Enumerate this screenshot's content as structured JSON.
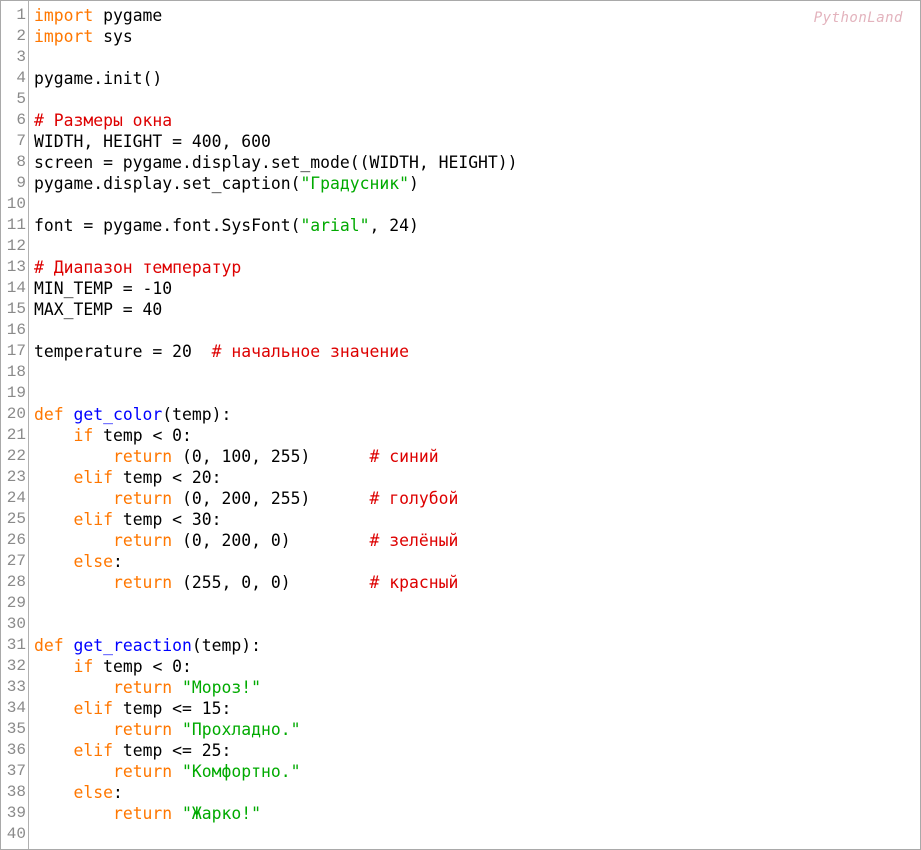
{
  "watermark": "PythonLand",
  "colors": {
    "keyword": "#ff7700",
    "function": "#0000ff",
    "string": "#00aa00",
    "comment": "#dd0000",
    "text": "#000000",
    "line_number": "#8a8a8a",
    "watermark": "#e3b3bd"
  },
  "lines": [
    {
      "num": "1",
      "tokens": [
        {
          "t": "kw",
          "v": "import"
        },
        {
          "t": "txt",
          "v": " pygame"
        }
      ]
    },
    {
      "num": "2",
      "tokens": [
        {
          "t": "kw",
          "v": "import"
        },
        {
          "t": "txt",
          "v": " sys"
        }
      ]
    },
    {
      "num": "3",
      "tokens": []
    },
    {
      "num": "4",
      "tokens": [
        {
          "t": "txt",
          "v": "pygame.init()"
        }
      ]
    },
    {
      "num": "5",
      "tokens": []
    },
    {
      "num": "6",
      "tokens": [
        {
          "t": "com",
          "v": "# Размеры окна"
        }
      ]
    },
    {
      "num": "7",
      "tokens": [
        {
          "t": "txt",
          "v": "WIDTH, HEIGHT = 400, 600"
        }
      ]
    },
    {
      "num": "8",
      "tokens": [
        {
          "t": "txt",
          "v": "screen = pygame.display.set_mode((WIDTH, HEIGHT))"
        }
      ]
    },
    {
      "num": "9",
      "tokens": [
        {
          "t": "txt",
          "v": "pygame.display.set_caption("
        },
        {
          "t": "str",
          "v": "\"Градусник\""
        },
        {
          "t": "txt",
          "v": ")"
        }
      ]
    },
    {
      "num": "10",
      "tokens": []
    },
    {
      "num": "11",
      "tokens": [
        {
          "t": "txt",
          "v": "font = pygame.font.SysFont("
        },
        {
          "t": "str",
          "v": "\"arial\""
        },
        {
          "t": "txt",
          "v": ", 24)"
        }
      ]
    },
    {
      "num": "12",
      "tokens": []
    },
    {
      "num": "13",
      "tokens": [
        {
          "t": "com",
          "v": "# Диапазон температур"
        }
      ]
    },
    {
      "num": "14",
      "tokens": [
        {
          "t": "txt",
          "v": "MIN_TEMP = -10"
        }
      ]
    },
    {
      "num": "15",
      "tokens": [
        {
          "t": "txt",
          "v": "MAX_TEMP = 40"
        }
      ]
    },
    {
      "num": "16",
      "tokens": []
    },
    {
      "num": "17",
      "tokens": [
        {
          "t": "txt",
          "v": "temperature = 20  "
        },
        {
          "t": "com",
          "v": "# начальное значение"
        }
      ]
    },
    {
      "num": "18",
      "tokens": []
    },
    {
      "num": "19",
      "tokens": []
    },
    {
      "num": "20",
      "tokens": [
        {
          "t": "kw",
          "v": "def"
        },
        {
          "t": "txt",
          "v": " "
        },
        {
          "t": "fn",
          "v": "get_color"
        },
        {
          "t": "txt",
          "v": "(temp):"
        }
      ]
    },
    {
      "num": "21",
      "tokens": [
        {
          "t": "txt",
          "v": "    "
        },
        {
          "t": "kw",
          "v": "if"
        },
        {
          "t": "txt",
          "v": " temp < 0:"
        }
      ]
    },
    {
      "num": "22",
      "tokens": [
        {
          "t": "txt",
          "v": "        "
        },
        {
          "t": "kw",
          "v": "return"
        },
        {
          "t": "txt",
          "v": " (0, 100, 255)      "
        },
        {
          "t": "com",
          "v": "# синий"
        }
      ]
    },
    {
      "num": "23",
      "tokens": [
        {
          "t": "txt",
          "v": "    "
        },
        {
          "t": "kw",
          "v": "elif"
        },
        {
          "t": "txt",
          "v": " temp < 20:"
        }
      ]
    },
    {
      "num": "24",
      "tokens": [
        {
          "t": "txt",
          "v": "        "
        },
        {
          "t": "kw",
          "v": "return"
        },
        {
          "t": "txt",
          "v": " (0, 200, 255)      "
        },
        {
          "t": "com",
          "v": "# голубой"
        }
      ]
    },
    {
      "num": "25",
      "tokens": [
        {
          "t": "txt",
          "v": "    "
        },
        {
          "t": "kw",
          "v": "elif"
        },
        {
          "t": "txt",
          "v": " temp < 30:"
        }
      ]
    },
    {
      "num": "26",
      "tokens": [
        {
          "t": "txt",
          "v": "        "
        },
        {
          "t": "kw",
          "v": "return"
        },
        {
          "t": "txt",
          "v": " (0, 200, 0)        "
        },
        {
          "t": "com",
          "v": "# зелёный"
        }
      ]
    },
    {
      "num": "27",
      "tokens": [
        {
          "t": "txt",
          "v": "    "
        },
        {
          "t": "kw",
          "v": "else"
        },
        {
          "t": "txt",
          "v": ":"
        }
      ]
    },
    {
      "num": "28",
      "tokens": [
        {
          "t": "txt",
          "v": "        "
        },
        {
          "t": "kw",
          "v": "return"
        },
        {
          "t": "txt",
          "v": " (255, 0, 0)        "
        },
        {
          "t": "com",
          "v": "# красный"
        }
      ]
    },
    {
      "num": "29",
      "tokens": []
    },
    {
      "num": "30",
      "tokens": []
    },
    {
      "num": "31",
      "tokens": [
        {
          "t": "kw",
          "v": "def"
        },
        {
          "t": "txt",
          "v": " "
        },
        {
          "t": "fn",
          "v": "get_reaction"
        },
        {
          "t": "txt",
          "v": "(temp):"
        }
      ]
    },
    {
      "num": "32",
      "tokens": [
        {
          "t": "txt",
          "v": "    "
        },
        {
          "t": "kw",
          "v": "if"
        },
        {
          "t": "txt",
          "v": " temp < 0:"
        }
      ]
    },
    {
      "num": "33",
      "tokens": [
        {
          "t": "txt",
          "v": "        "
        },
        {
          "t": "kw",
          "v": "return"
        },
        {
          "t": "txt",
          "v": " "
        },
        {
          "t": "str",
          "v": "\"Мороз!\""
        }
      ]
    },
    {
      "num": "34",
      "tokens": [
        {
          "t": "txt",
          "v": "    "
        },
        {
          "t": "kw",
          "v": "elif"
        },
        {
          "t": "txt",
          "v": " temp <= 15:"
        }
      ]
    },
    {
      "num": "35",
      "tokens": [
        {
          "t": "txt",
          "v": "        "
        },
        {
          "t": "kw",
          "v": "return"
        },
        {
          "t": "txt",
          "v": " "
        },
        {
          "t": "str",
          "v": "\"Прохладно.\""
        }
      ]
    },
    {
      "num": "36",
      "tokens": [
        {
          "t": "txt",
          "v": "    "
        },
        {
          "t": "kw",
          "v": "elif"
        },
        {
          "t": "txt",
          "v": " temp <= 25:"
        }
      ]
    },
    {
      "num": "37",
      "tokens": [
        {
          "t": "txt",
          "v": "        "
        },
        {
          "t": "kw",
          "v": "return"
        },
        {
          "t": "txt",
          "v": " "
        },
        {
          "t": "str",
          "v": "\"Комфортно.\""
        }
      ]
    },
    {
      "num": "38",
      "tokens": [
        {
          "t": "txt",
          "v": "    "
        },
        {
          "t": "kw",
          "v": "else"
        },
        {
          "t": "txt",
          "v": ":"
        }
      ]
    },
    {
      "num": "39",
      "tokens": [
        {
          "t": "txt",
          "v": "        "
        },
        {
          "t": "kw",
          "v": "return"
        },
        {
          "t": "txt",
          "v": " "
        },
        {
          "t": "str",
          "v": "\"Жарко!\""
        }
      ]
    },
    {
      "num": "40",
      "tokens": []
    }
  ]
}
